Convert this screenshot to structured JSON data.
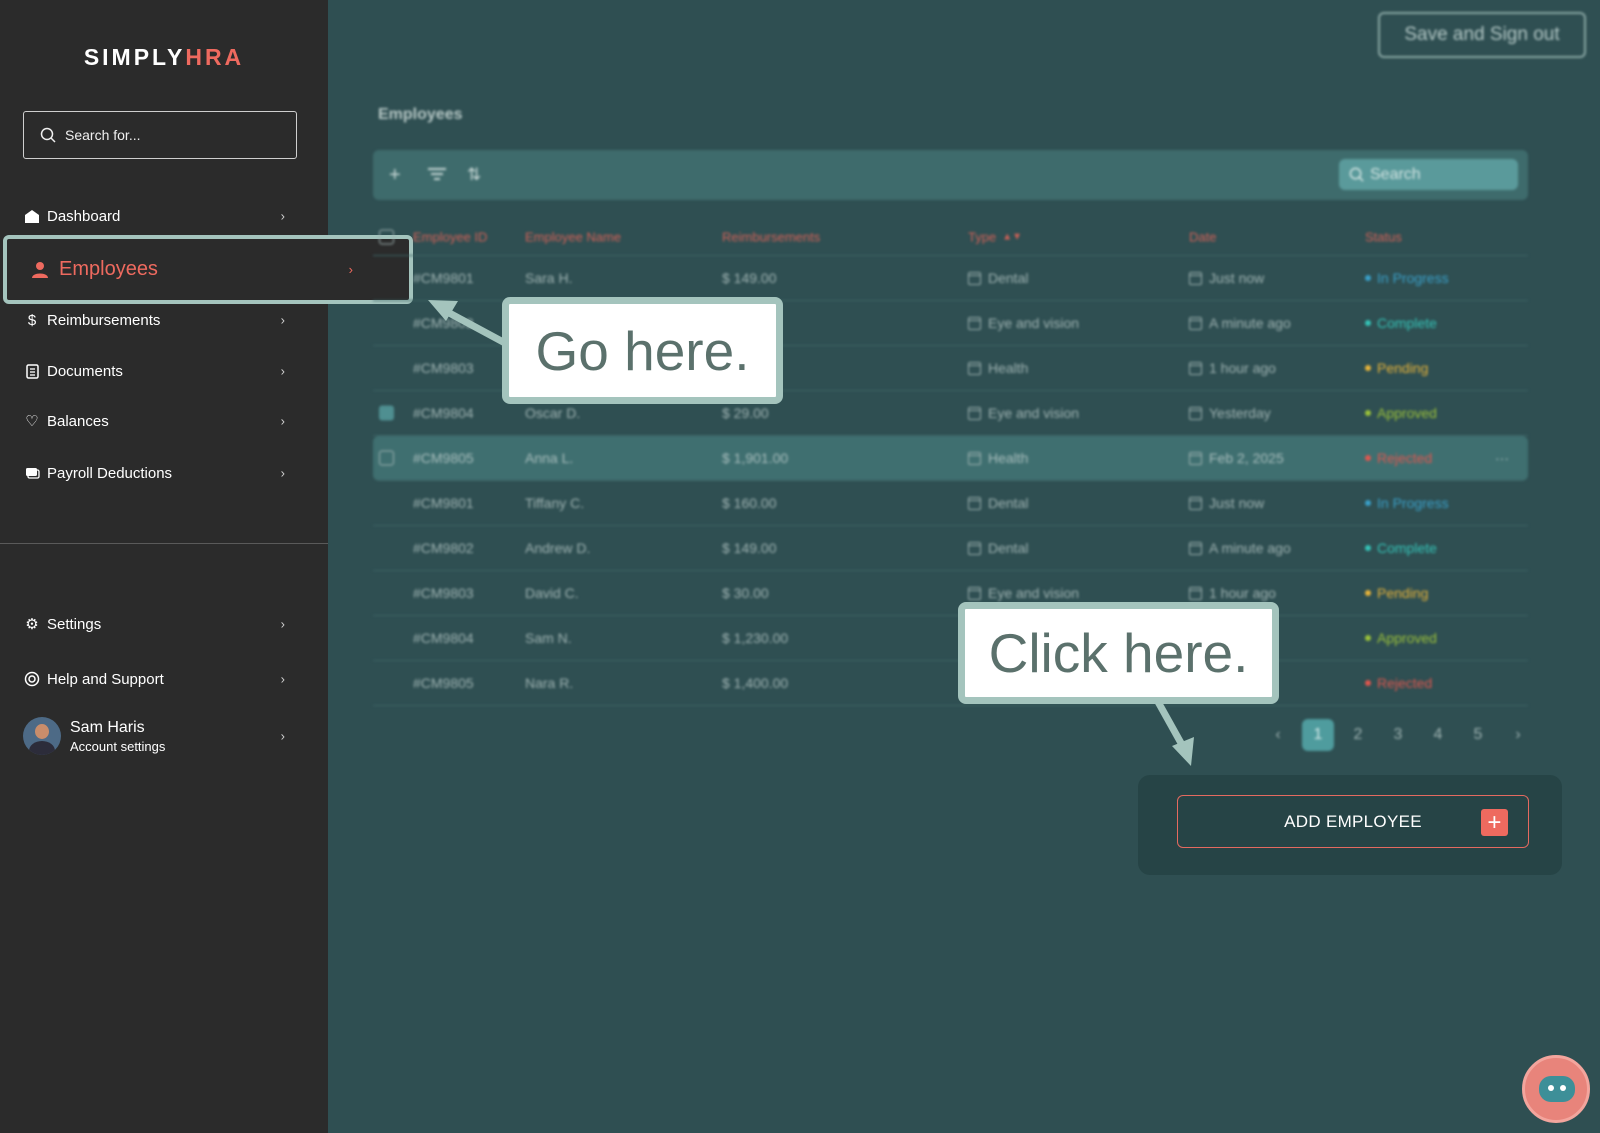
{
  "app": {
    "logo_main": "SIMPLY",
    "logo_accent": "HRA"
  },
  "colors": {
    "accent": "#ee6a5f",
    "sidebar_bg": "#2b2b2b",
    "main_bg": "#2f4f52",
    "highlight": "#a4c4bd"
  },
  "sidebar": {
    "search_placeholder": "Search for...",
    "items": [
      {
        "label": "Dashboard",
        "icon": "home-icon"
      },
      {
        "label": "Employees",
        "icon": "person-icon",
        "active": true
      },
      {
        "label": "Reimbursements",
        "icon": "dollar-icon"
      },
      {
        "label": "Documents",
        "icon": "document-icon"
      },
      {
        "label": "Balances",
        "icon": "heart-icon"
      },
      {
        "label": "Payroll Deductions",
        "icon": "payroll-icon"
      }
    ],
    "bottom_items": [
      {
        "label": "Settings",
        "icon": "gear-icon"
      },
      {
        "label": "Help and Support",
        "icon": "lifebuoy-icon"
      }
    ],
    "user": {
      "name": "Sam Haris",
      "subtitle": "Account settings"
    }
  },
  "header": {
    "signout_label": "Save and Sign out"
  },
  "main": {
    "title": "Employees",
    "search_placeholder": "Search",
    "columns": [
      "Employee ID",
      "Employee Name",
      "Reimbursements",
      "Type",
      "Date",
      "Status"
    ],
    "rows": [
      {
        "id": "#CM9801",
        "name": "Sara H.",
        "amount": "$ 149.00",
        "type": "Dental",
        "date": "Just now",
        "status": "In Progress",
        "status_color": "#3aa0c9",
        "checked": false,
        "selected": false
      },
      {
        "id": "#CM9802",
        "name": "",
        "amount": "",
        "type": "Eye and vision",
        "date": "A minute ago",
        "status": "Complete",
        "status_color": "#35c4b8",
        "checked": false,
        "selected": false
      },
      {
        "id": "#CM9803",
        "name": "",
        "amount": "",
        "type": "Health",
        "date": "1 hour ago",
        "status": "Pending",
        "status_color": "#e8b43a",
        "checked": false,
        "selected": false
      },
      {
        "id": "#CM9804",
        "name": "Oscar D.",
        "amount": "$ 29.00",
        "type": "Eye and vision",
        "date": "Yesterday",
        "status": "Approved",
        "status_color": "#9cc23a",
        "checked": true,
        "selected": false
      },
      {
        "id": "#CM9805",
        "name": "Anna L.",
        "amount": "$ 1,901.00",
        "type": "Health",
        "date": "Feb 2, 2025",
        "status": "Rejected",
        "status_color": "#e0564e",
        "checked": false,
        "selected": true
      },
      {
        "id": "#CM9801",
        "name": "Tiffany C.",
        "amount": "$ 160.00",
        "type": "Dental",
        "date": "Just now",
        "status": "In Progress",
        "status_color": "#3aa0c9",
        "checked": false,
        "selected": false
      },
      {
        "id": "#CM9802",
        "name": "Andrew D.",
        "amount": "$ 149.00",
        "type": "Dental",
        "date": "A minute ago",
        "status": "Complete",
        "status_color": "#35c4b8",
        "checked": false,
        "selected": false
      },
      {
        "id": "#CM9803",
        "name": "David C.",
        "amount": "$ 30.00",
        "type": "Eye and vision",
        "date": "1 hour ago",
        "status": "Pending",
        "status_color": "#e8b43a",
        "checked": false,
        "selected": false
      },
      {
        "id": "#CM9804",
        "name": "Sam N.",
        "amount": "$ 1,230.00",
        "type": "",
        "date": "",
        "status": "Approved",
        "status_color": "#9cc23a",
        "checked": false,
        "selected": false
      },
      {
        "id": "#CM9805",
        "name": "Nara R.",
        "amount": "$ 1,400.00",
        "type": "",
        "date": "",
        "status": "Rejected",
        "status_color": "#e0564e",
        "checked": false,
        "selected": false
      }
    ],
    "pagination": {
      "pages": [
        "1",
        "2",
        "3",
        "4",
        "5"
      ],
      "current": "1"
    }
  },
  "add_employee": {
    "label": "ADD EMPLOYEE"
  },
  "annotations": {
    "go_here": "Go here.",
    "click_here": "Click here."
  }
}
